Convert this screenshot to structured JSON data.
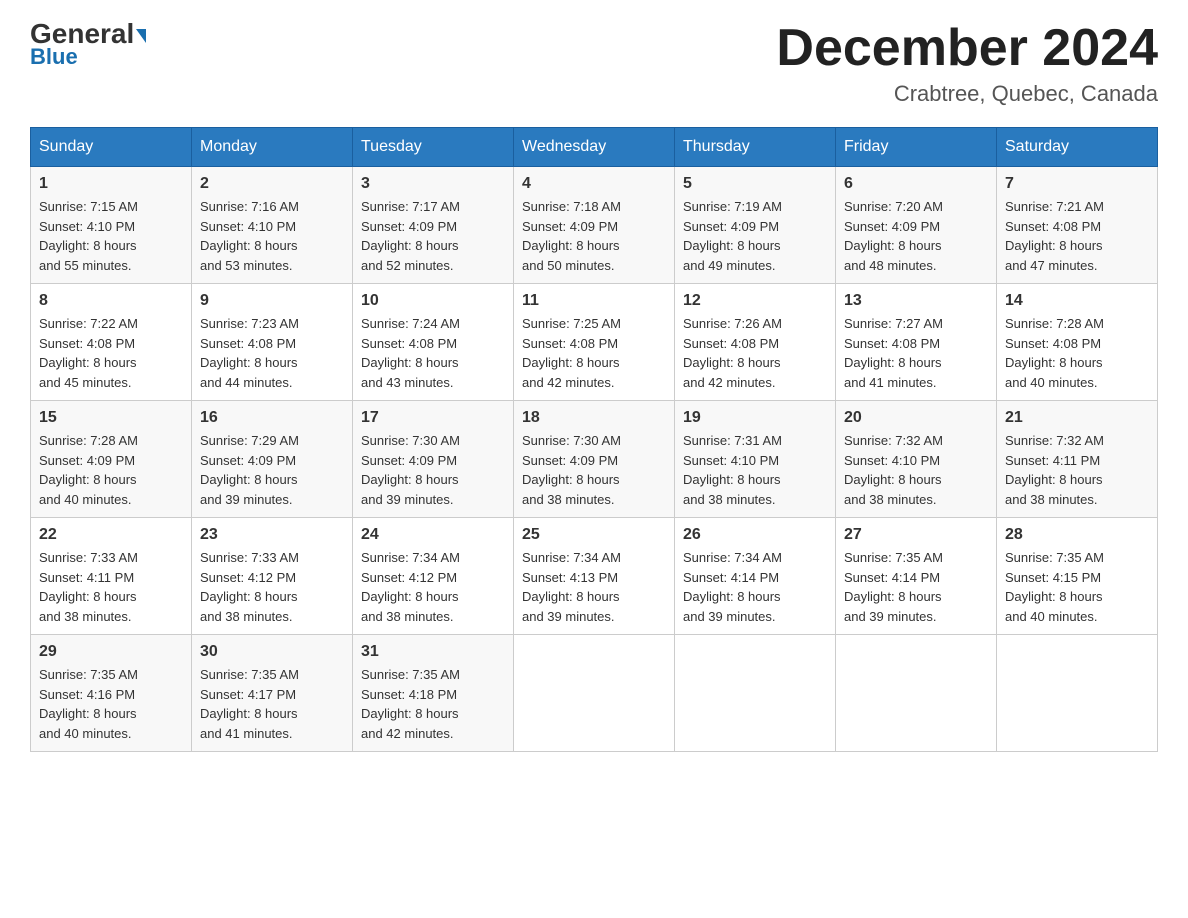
{
  "header": {
    "logo_general": "General",
    "logo_blue": "Blue",
    "month_title": "December 2024",
    "location": "Crabtree, Quebec, Canada"
  },
  "days_of_week": [
    "Sunday",
    "Monday",
    "Tuesday",
    "Wednesday",
    "Thursday",
    "Friday",
    "Saturday"
  ],
  "weeks": [
    [
      {
        "day": "1",
        "sunrise": "7:15 AM",
        "sunset": "4:10 PM",
        "daylight": "8 hours and 55 minutes."
      },
      {
        "day": "2",
        "sunrise": "7:16 AM",
        "sunset": "4:10 PM",
        "daylight": "8 hours and 53 minutes."
      },
      {
        "day": "3",
        "sunrise": "7:17 AM",
        "sunset": "4:09 PM",
        "daylight": "8 hours and 52 minutes."
      },
      {
        "day": "4",
        "sunrise": "7:18 AM",
        "sunset": "4:09 PM",
        "daylight": "8 hours and 50 minutes."
      },
      {
        "day": "5",
        "sunrise": "7:19 AM",
        "sunset": "4:09 PM",
        "daylight": "8 hours and 49 minutes."
      },
      {
        "day": "6",
        "sunrise": "7:20 AM",
        "sunset": "4:09 PM",
        "daylight": "8 hours and 48 minutes."
      },
      {
        "day": "7",
        "sunrise": "7:21 AM",
        "sunset": "4:08 PM",
        "daylight": "8 hours and 47 minutes."
      }
    ],
    [
      {
        "day": "8",
        "sunrise": "7:22 AM",
        "sunset": "4:08 PM",
        "daylight": "8 hours and 45 minutes."
      },
      {
        "day": "9",
        "sunrise": "7:23 AM",
        "sunset": "4:08 PM",
        "daylight": "8 hours and 44 minutes."
      },
      {
        "day": "10",
        "sunrise": "7:24 AM",
        "sunset": "4:08 PM",
        "daylight": "8 hours and 43 minutes."
      },
      {
        "day": "11",
        "sunrise": "7:25 AM",
        "sunset": "4:08 PM",
        "daylight": "8 hours and 42 minutes."
      },
      {
        "day": "12",
        "sunrise": "7:26 AM",
        "sunset": "4:08 PM",
        "daylight": "8 hours and 42 minutes."
      },
      {
        "day": "13",
        "sunrise": "7:27 AM",
        "sunset": "4:08 PM",
        "daylight": "8 hours and 41 minutes."
      },
      {
        "day": "14",
        "sunrise": "7:28 AM",
        "sunset": "4:08 PM",
        "daylight": "8 hours and 40 minutes."
      }
    ],
    [
      {
        "day": "15",
        "sunrise": "7:28 AM",
        "sunset": "4:09 PM",
        "daylight": "8 hours and 40 minutes."
      },
      {
        "day": "16",
        "sunrise": "7:29 AM",
        "sunset": "4:09 PM",
        "daylight": "8 hours and 39 minutes."
      },
      {
        "day": "17",
        "sunrise": "7:30 AM",
        "sunset": "4:09 PM",
        "daylight": "8 hours and 39 minutes."
      },
      {
        "day": "18",
        "sunrise": "7:30 AM",
        "sunset": "4:09 PM",
        "daylight": "8 hours and 38 minutes."
      },
      {
        "day": "19",
        "sunrise": "7:31 AM",
        "sunset": "4:10 PM",
        "daylight": "8 hours and 38 minutes."
      },
      {
        "day": "20",
        "sunrise": "7:32 AM",
        "sunset": "4:10 PM",
        "daylight": "8 hours and 38 minutes."
      },
      {
        "day": "21",
        "sunrise": "7:32 AM",
        "sunset": "4:11 PM",
        "daylight": "8 hours and 38 minutes."
      }
    ],
    [
      {
        "day": "22",
        "sunrise": "7:33 AM",
        "sunset": "4:11 PM",
        "daylight": "8 hours and 38 minutes."
      },
      {
        "day": "23",
        "sunrise": "7:33 AM",
        "sunset": "4:12 PM",
        "daylight": "8 hours and 38 minutes."
      },
      {
        "day": "24",
        "sunrise": "7:34 AM",
        "sunset": "4:12 PM",
        "daylight": "8 hours and 38 minutes."
      },
      {
        "day": "25",
        "sunrise": "7:34 AM",
        "sunset": "4:13 PM",
        "daylight": "8 hours and 39 minutes."
      },
      {
        "day": "26",
        "sunrise": "7:34 AM",
        "sunset": "4:14 PM",
        "daylight": "8 hours and 39 minutes."
      },
      {
        "day": "27",
        "sunrise": "7:35 AM",
        "sunset": "4:14 PM",
        "daylight": "8 hours and 39 minutes."
      },
      {
        "day": "28",
        "sunrise": "7:35 AM",
        "sunset": "4:15 PM",
        "daylight": "8 hours and 40 minutes."
      }
    ],
    [
      {
        "day": "29",
        "sunrise": "7:35 AM",
        "sunset": "4:16 PM",
        "daylight": "8 hours and 40 minutes."
      },
      {
        "day": "30",
        "sunrise": "7:35 AM",
        "sunset": "4:17 PM",
        "daylight": "8 hours and 41 minutes."
      },
      {
        "day": "31",
        "sunrise": "7:35 AM",
        "sunset": "4:18 PM",
        "daylight": "8 hours and 42 minutes."
      },
      null,
      null,
      null,
      null
    ]
  ],
  "labels": {
    "sunrise": "Sunrise:",
    "sunset": "Sunset:",
    "daylight": "Daylight:"
  }
}
